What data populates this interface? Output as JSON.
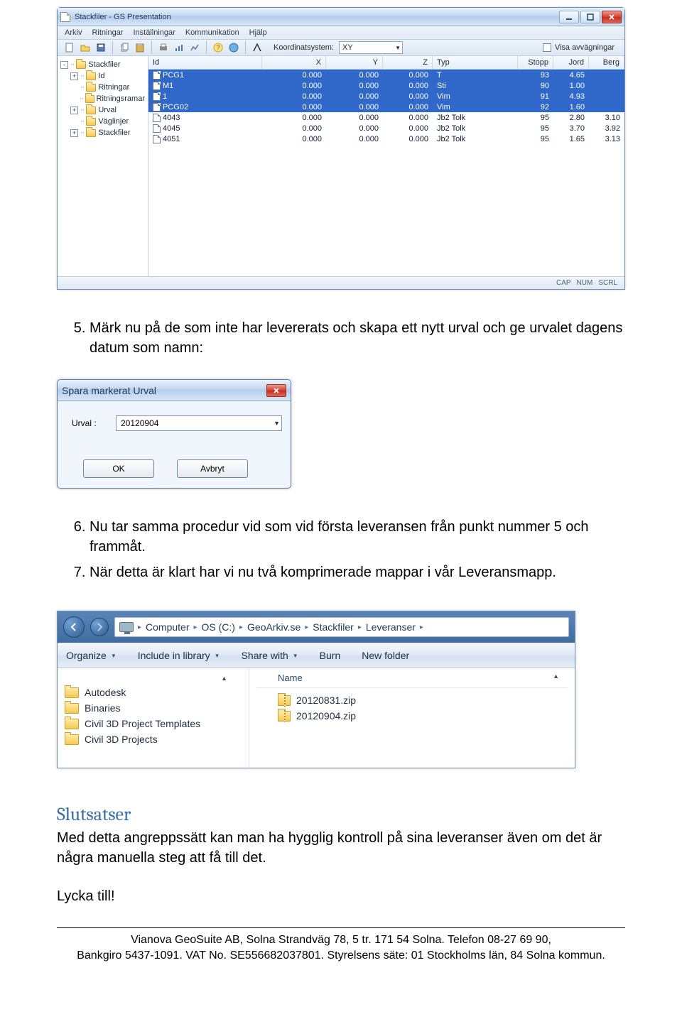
{
  "app_window": {
    "title": "Stackfiler - GS Presentation",
    "menubar": [
      "Arkiv",
      "Ritningar",
      "Inställningar",
      "Kommunikation",
      "Hjälp"
    ],
    "toolbar": {
      "coord_label": "Koordinatsystem:",
      "coord_value": "XY",
      "checkbox_label": "Visa avvägningar"
    },
    "tree": [
      {
        "indent": 0,
        "toggle": "-",
        "label": "Stackfiler"
      },
      {
        "indent": 1,
        "toggle": "+",
        "label": "Id"
      },
      {
        "indent": 1,
        "toggle": "",
        "label": "Ritningar"
      },
      {
        "indent": 1,
        "toggle": "",
        "label": "Ritningsramar"
      },
      {
        "indent": 1,
        "toggle": "+",
        "label": "Urval"
      },
      {
        "indent": 1,
        "toggle": "",
        "label": "Väglinjer"
      },
      {
        "indent": 1,
        "toggle": "+",
        "label": "Stackfiler"
      }
    ],
    "columns": [
      "Id",
      "X",
      "Y",
      "Z",
      "Typ",
      "Stopp",
      "Jord",
      "Berg"
    ],
    "rows": [
      {
        "sel": true,
        "id": "PCG1",
        "x": "0.000",
        "y": "0.000",
        "z": "0.000",
        "typ": "T",
        "stopp": "93",
        "jord": "4.65",
        "berg": ""
      },
      {
        "sel": true,
        "id": "M1",
        "x": "0.000",
        "y": "0.000",
        "z": "0.000",
        "typ": "Sti",
        "stopp": "90",
        "jord": "1.00",
        "berg": ""
      },
      {
        "sel": true,
        "id": "1",
        "x": "0.000",
        "y": "0.000",
        "z": "0.000",
        "typ": "Vim",
        "stopp": "91",
        "jord": "4.93",
        "berg": ""
      },
      {
        "sel": true,
        "id": "PCG02",
        "x": "0.000",
        "y": "0.000",
        "z": "0.000",
        "typ": "Vim",
        "stopp": "92",
        "jord": "1.60",
        "berg": ""
      },
      {
        "sel": false,
        "id": "4043",
        "x": "0.000",
        "y": "0.000",
        "z": "0.000",
        "typ": "Jb2 Tolk",
        "stopp": "95",
        "jord": "2.80",
        "berg": "3.10"
      },
      {
        "sel": false,
        "id": "4045",
        "x": "0.000",
        "y": "0.000",
        "z": "0.000",
        "typ": "Jb2 Tolk",
        "stopp": "95",
        "jord": "3.70",
        "berg": "3.92"
      },
      {
        "sel": false,
        "id": "4051",
        "x": "0.000",
        "y": "0.000",
        "z": "0.000",
        "typ": "Jb2 Tolk",
        "stopp": "95",
        "jord": "1.65",
        "berg": "3.13"
      }
    ],
    "status": [
      "CAP",
      "NUM",
      "SCRL"
    ]
  },
  "doc": {
    "step5_num": "5.",
    "step5": "Märk nu på de som inte har levererats och skapa ett nytt urval och ge urvalet dagens datum som namn:",
    "step6_num": "6.",
    "step6": "Nu tar samma procedur vid som vid första leveransen från punkt nummer 5 och frammåt.",
    "step7_num": "7.",
    "step7": "När detta är klart har vi nu två komprimerade mappar i vår Leveransmapp."
  },
  "dialog": {
    "title": "Spara markerat Urval",
    "field_label": "Urval :",
    "field_value": "20120904",
    "ok": "OK",
    "cancel": "Avbryt"
  },
  "explorer": {
    "breadcrumb": [
      "Computer",
      "OS (C:)",
      "GeoArkiv.se",
      "Stackfiler",
      "Leveranser"
    ],
    "toolbar": {
      "organize": "Organize",
      "include": "Include in library",
      "share": "Share with",
      "burn": "Burn",
      "newfolder": "New folder"
    },
    "col_name": "Name",
    "left_folders": [
      "Autodesk",
      "Binaries",
      "Civil 3D Project Templates",
      "Civil 3D Projects"
    ],
    "files": [
      "20120831.zip",
      "20120904.zip"
    ]
  },
  "slutsatser": {
    "heading": "Slutsatser",
    "p1": "Med detta angreppssätt kan man ha hygglig kontroll på sina leveranser även om det är några manuella steg att få till det.",
    "p2": "Lycka till!"
  },
  "footer": {
    "l1": "Vianova GeoSuite AB, Solna Strandväg 78, 5 tr. 171 54 Solna. Telefon 08-27 69 90,",
    "l2": "Bankgiro 5437-1091. VAT No. SE556682037801. Styrelsens säte: 01 Stockholms län, 84 Solna kommun."
  }
}
